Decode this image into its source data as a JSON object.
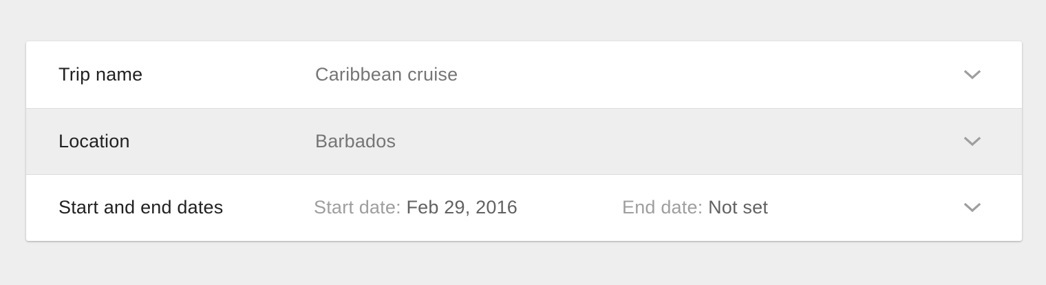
{
  "rows": [
    {
      "label": "Trip name",
      "value": "Caribbean cruise",
      "expand_icon": "chevron-down-icon"
    },
    {
      "label": "Location",
      "value": "Barbados",
      "expand_icon": "chevron-down-icon",
      "highlighted": true
    },
    {
      "label": "Start and end dates",
      "start_caption": "Start date:",
      "start_value": "Feb 29, 2016",
      "end_caption": "End date:",
      "end_value": "Not set",
      "expand_icon": "chevron-down-icon"
    }
  ],
  "colors": {
    "background": "#eeeeee",
    "panel": "#ffffff",
    "highlight_row": "#eeeeee",
    "label_text": "#212121",
    "value_text": "#757575",
    "caption_text": "#9e9e9e",
    "chevron": "#9e9e9e"
  }
}
